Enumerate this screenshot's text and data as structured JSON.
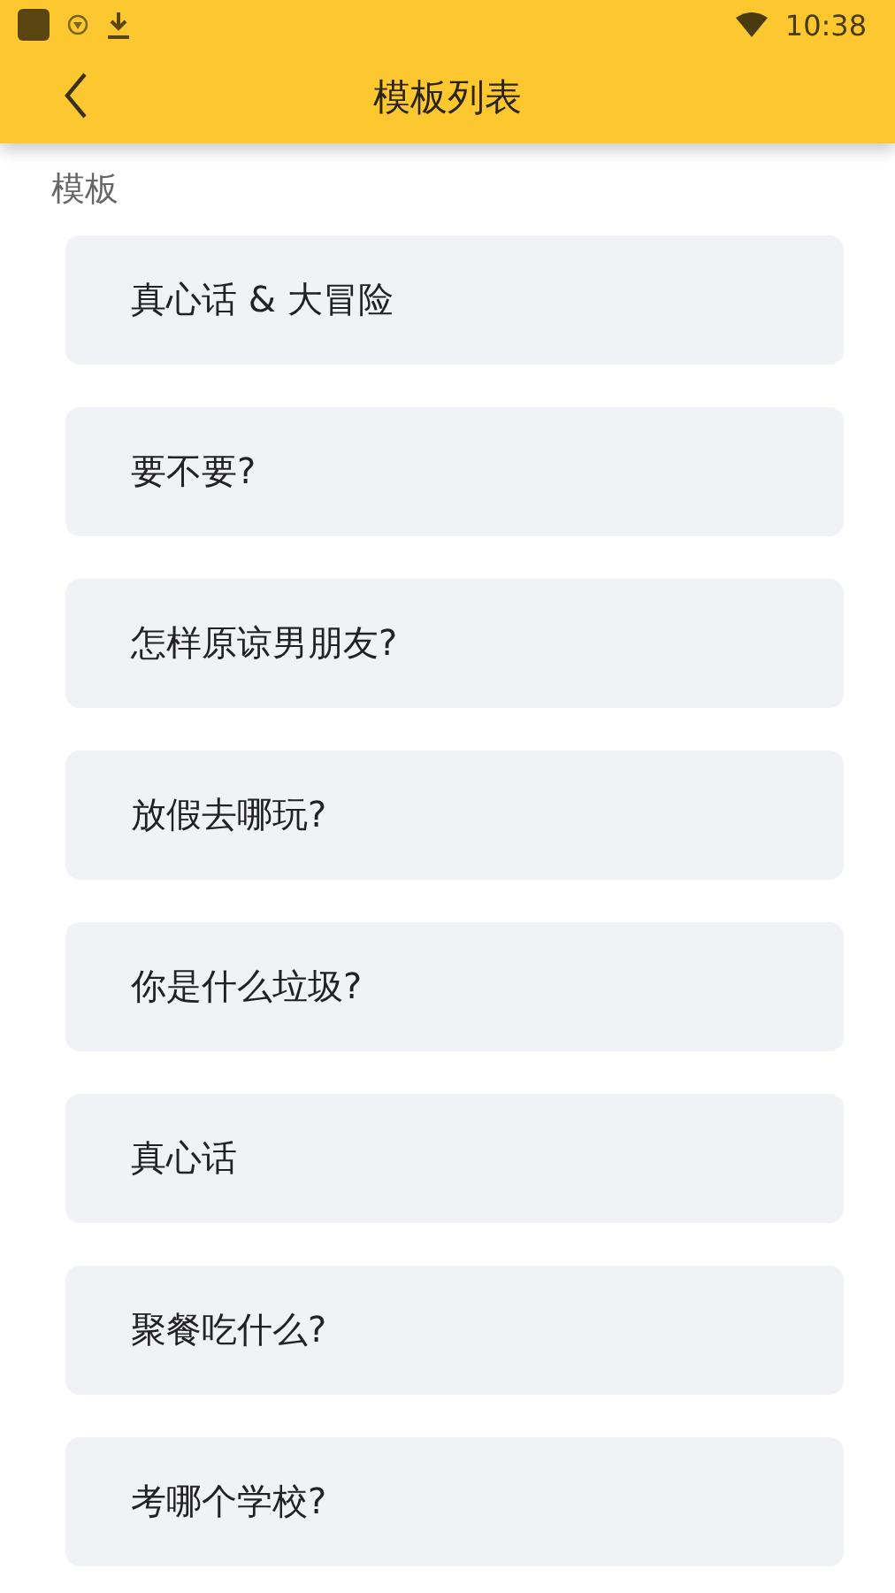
{
  "status_bar": {
    "time": "10:38"
  },
  "header": {
    "title": "模板列表"
  },
  "section": {
    "label": "模板"
  },
  "templates": [
    {
      "label": "真心话 & 大冒险"
    },
    {
      "label": "要不要?"
    },
    {
      "label": "怎样原谅男朋友?"
    },
    {
      "label": "放假去哪玩?"
    },
    {
      "label": "你是什么垃圾?"
    },
    {
      "label": "真心话"
    },
    {
      "label": "聚餐吃什么?"
    },
    {
      "label": "考哪个学校?"
    }
  ]
}
